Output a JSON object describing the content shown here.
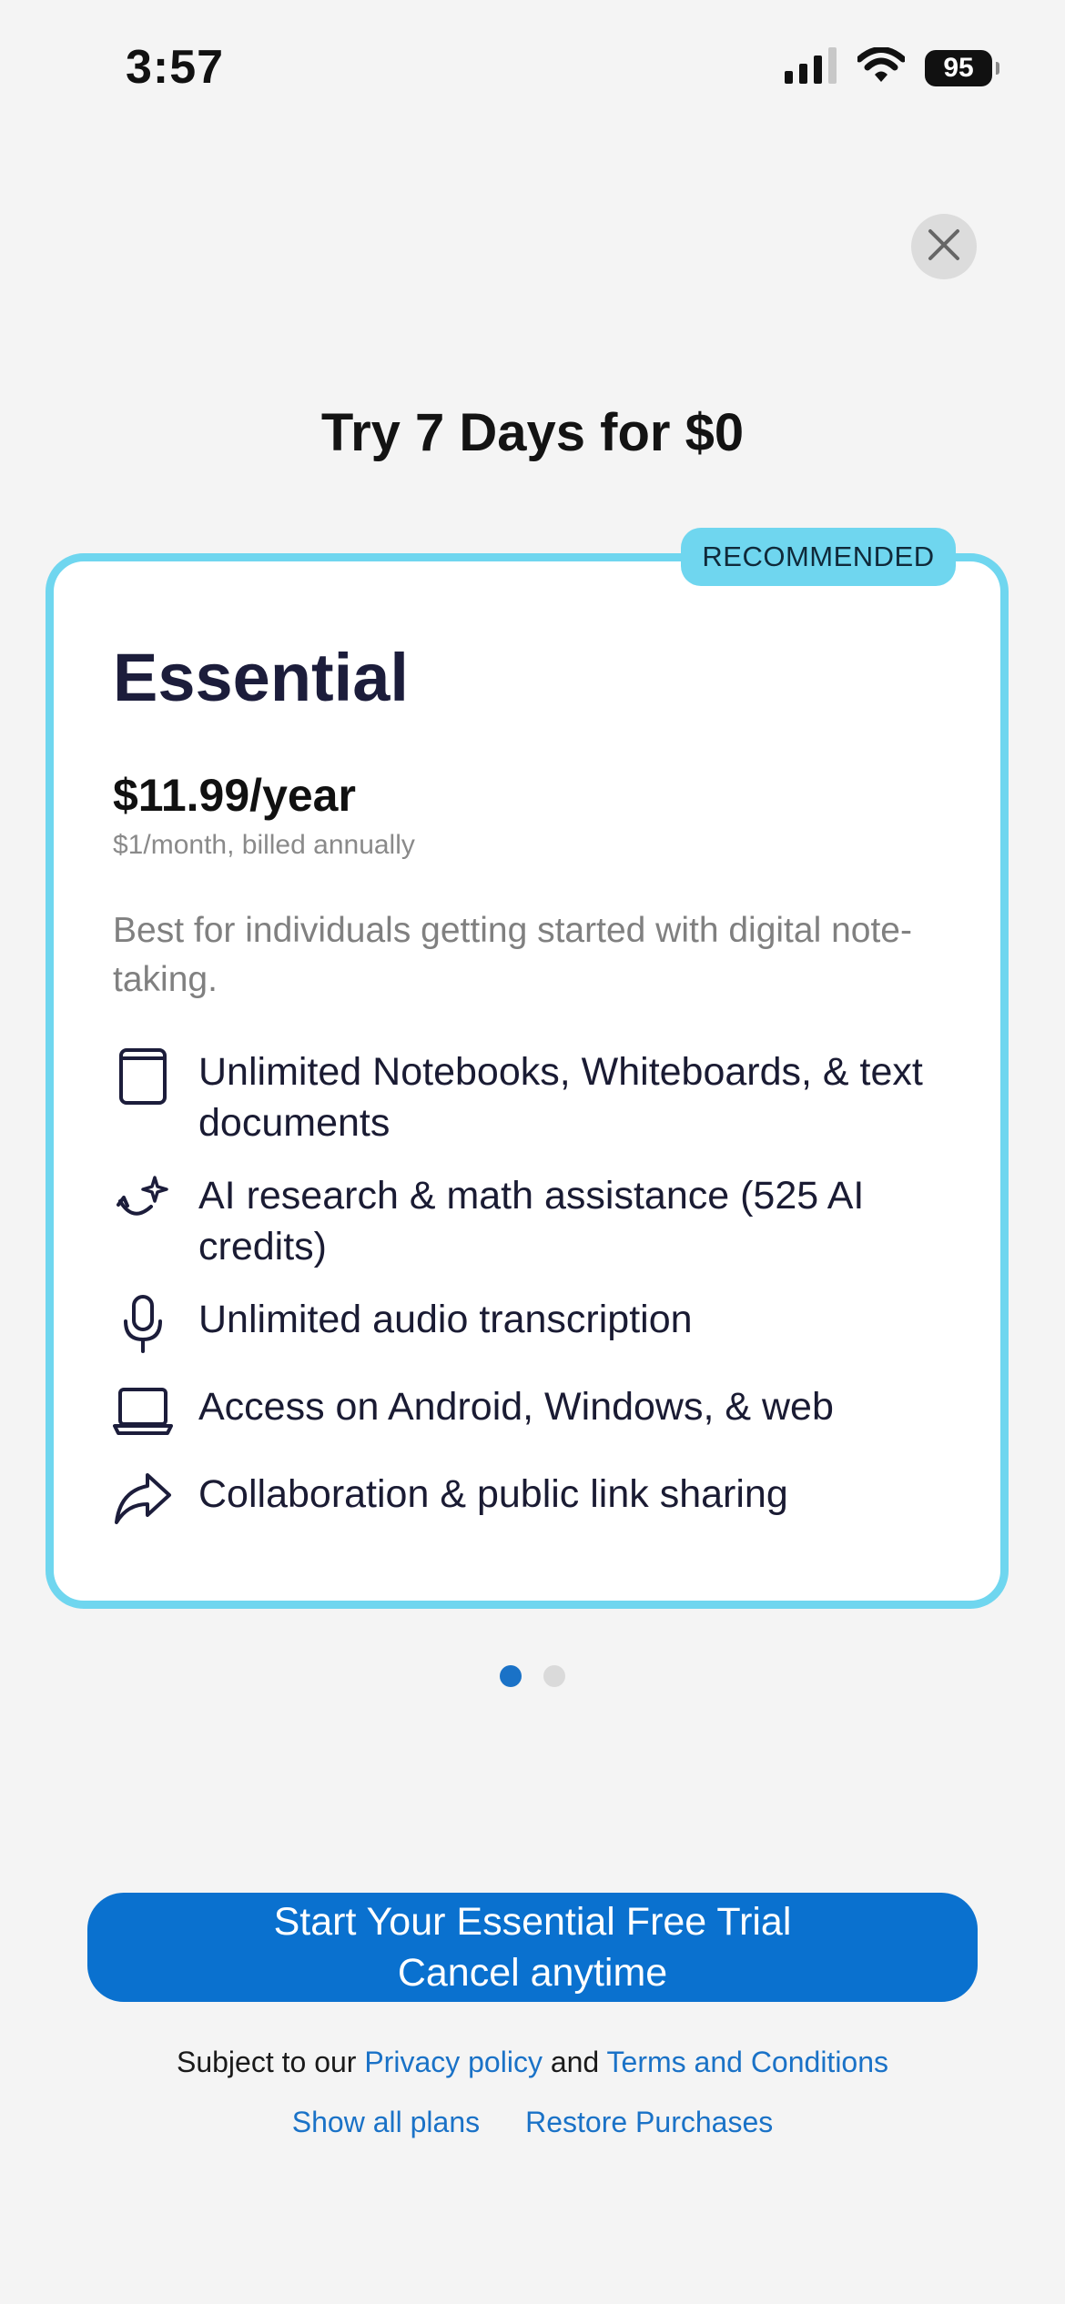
{
  "status_bar": {
    "time": "3:57",
    "battery": "95",
    "icons": [
      "signal-icon",
      "wifi-icon",
      "battery-icon"
    ]
  },
  "header": {
    "close_icon": "close-icon",
    "title": "Try 7 Days for $0"
  },
  "plan": {
    "badge": "RECOMMENDED",
    "name": "Essential",
    "price": "$11.99/year",
    "billing": "$1/month, billed annually",
    "description": "Best for individuals getting started with digital note-taking.",
    "features": [
      {
        "icon": "notebook-icon",
        "text": "Unlimited Notebooks, Whiteboards, & text documents"
      },
      {
        "icon": "ai-sparkle-icon",
        "text": "AI research & math assistance (525 AI credits)"
      },
      {
        "icon": "microphone-icon",
        "text": "Unlimited audio transcription"
      },
      {
        "icon": "laptop-icon",
        "text": "Access on Android, Windows, & web"
      },
      {
        "icon": "share-icon",
        "text": "Collaboration & public link sharing"
      }
    ]
  },
  "pager": {
    "count": 2,
    "active_index": 0
  },
  "cta": {
    "line1": "Start Your Essential Free Trial",
    "line2": "Cancel anytime"
  },
  "legal": {
    "prefix": "Subject to our",
    "privacy_link": "Privacy policy",
    "conjunction": "and",
    "terms_link": "Terms and Conditions"
  },
  "footer": {
    "show_all_plans": "Show all plans",
    "restore_purchases": "Restore Purchases"
  },
  "colors": {
    "accent": "#0a71cf",
    "card_border": "#6fd6ef",
    "link": "#1a72c7",
    "background": "#f4f4f4"
  }
}
